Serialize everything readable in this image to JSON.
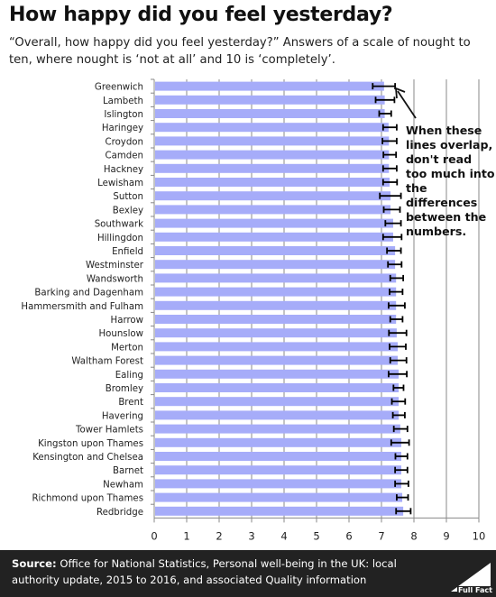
{
  "title": "How happy did you feel yesterday?",
  "subtitle": "“Overall, how happy did you feel yesterday?” Answers of a scale of nought to ten, where nought is ‘not at all’ and 10 is ‘completely’.",
  "annotation": "When these lines overlap, don't read too much into the differences between the numbers.",
  "footer": {
    "source_label": "Source:",
    "source_text": " Office for National Statistics, Personal well-being in the UK: local authority update, 2015 to 2016, and associated Quality information",
    "logo_text": "Full Fact"
  },
  "colors": {
    "bar": "#a6acf9",
    "error_bar": "#000000",
    "grid": "#888888",
    "footer_bg": "#222222"
  },
  "chart_data": {
    "type": "bar",
    "orientation": "horizontal",
    "title": "How happy did you feel yesterday?",
    "xlabel": "",
    "ylabel": "",
    "xlim": [
      0,
      10
    ],
    "xticks": [
      0,
      1,
      2,
      3,
      4,
      5,
      6,
      7,
      8,
      9,
      10
    ],
    "grid": true,
    "categories": [
      "Greenwich",
      "Lambeth",
      "Islington",
      "Haringey",
      "Croydon",
      "Camden",
      "Hackney",
      "Lewisham",
      "Sutton",
      "Bexley",
      "Southwark",
      "Hillingdon",
      "Enfield",
      "Westminster",
      "Wandsworth",
      "Barking and Dagenham",
      "Hammersmith and Fulham",
      "Harrow",
      "Hounslow",
      "Merton",
      "Waltham Forest",
      "Ealing",
      "Bromley",
      "Brent",
      "Havering",
      "Tower Hamlets",
      "Kingston upon Thames",
      "Kensington and Chelsea",
      "Barnet",
      "Newham",
      "Richmond upon Thames",
      "Redbridge"
    ],
    "values": [
      7.08,
      7.1,
      7.1,
      7.22,
      7.23,
      7.23,
      7.23,
      7.25,
      7.28,
      7.28,
      7.36,
      7.36,
      7.42,
      7.42,
      7.45,
      7.45,
      7.45,
      7.45,
      7.47,
      7.5,
      7.5,
      7.53,
      7.53,
      7.53,
      7.53,
      7.58,
      7.61,
      7.61,
      7.61,
      7.61,
      7.64,
      7.67
    ],
    "error_low": [
      6.73,
      6.82,
      6.93,
      7.05,
      7.03,
      7.06,
      7.05,
      7.05,
      6.95,
      7.07,
      7.12,
      7.05,
      7.17,
      7.2,
      7.27,
      7.25,
      7.22,
      7.27,
      7.23,
      7.25,
      7.27,
      7.22,
      7.37,
      7.32,
      7.35,
      7.38,
      7.3,
      7.43,
      7.42,
      7.42,
      7.47,
      7.45
    ],
    "error_high": [
      7.42,
      7.4,
      7.3,
      7.47,
      7.47,
      7.45,
      7.47,
      7.48,
      7.6,
      7.57,
      7.6,
      7.62,
      7.6,
      7.62,
      7.67,
      7.65,
      7.72,
      7.65,
      7.77,
      7.75,
      7.77,
      7.78,
      7.68,
      7.73,
      7.72,
      7.8,
      7.85,
      7.8,
      7.8,
      7.83,
      7.82,
      7.9
    ]
  }
}
